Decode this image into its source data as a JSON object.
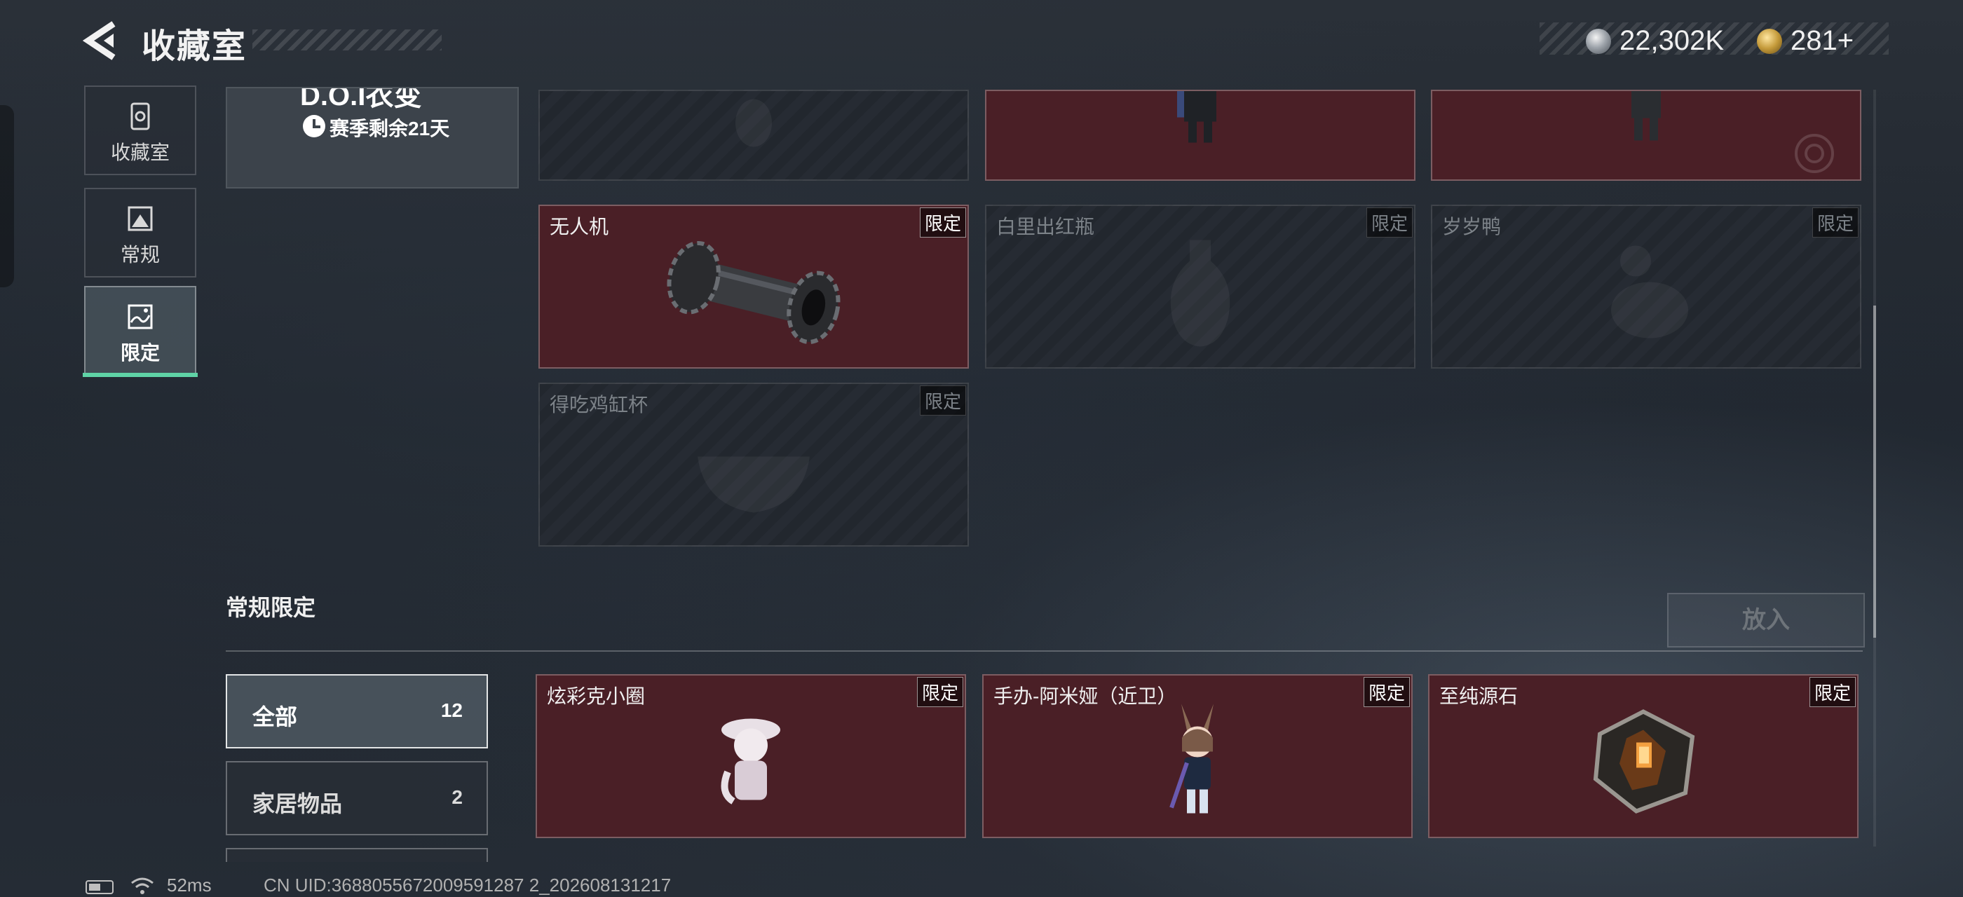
{
  "header": {
    "title": "收藏室",
    "currency": [
      {
        "value": "22,302K",
        "icon": "silver-coin-icon"
      },
      {
        "value": "281+",
        "icon": "gold-coin-icon"
      }
    ]
  },
  "nav": {
    "items": [
      {
        "label": "收藏室",
        "icon": "vault-icon",
        "active": false
      },
      {
        "label": "常规",
        "icon": "picture-frame-icon",
        "active": false
      },
      {
        "label": "限定",
        "icon": "landscape-icon",
        "active": true
      }
    ]
  },
  "season": {
    "title_partial": "D.O.I衣变",
    "remaining": "赛季剩余21天"
  },
  "limited_items": [
    {
      "name": "",
      "tag": "",
      "owned": false
    },
    {
      "name": "",
      "tag": "",
      "owned": true
    },
    {
      "name": "",
      "tag": "",
      "owned": true
    },
    {
      "name": "无人机",
      "tag": "限定",
      "owned": true
    },
    {
      "name": "白里出红瓶",
      "tag": "限定",
      "owned": false
    },
    {
      "name": "岁岁鸭",
      "tag": "限定",
      "owned": false
    },
    {
      "name": "得吃鸡缸杯",
      "tag": "限定",
      "owned": false
    }
  ],
  "section": {
    "title": "常规限定",
    "put_button": "放入",
    "filters": [
      {
        "label": "全部",
        "count": "12",
        "active": true
      },
      {
        "label": "家居物品",
        "count": "2",
        "active": false
      }
    ],
    "items": [
      {
        "name": "炫彩克小圈",
        "tag": "限定",
        "owned": true
      },
      {
        "name": "手办-阿米娅（近卫）",
        "tag": "限定",
        "owned": true
      },
      {
        "name": "至纯源石",
        "tag": "限定",
        "owned": true
      }
    ]
  },
  "footer": {
    "ping": "52ms",
    "uid": "CN UID:3688055672009591287 2_202608131217"
  },
  "colors": {
    "accent": "#5fd3a6",
    "owned_card": "#4a1f26",
    "background": "#1f252d"
  }
}
